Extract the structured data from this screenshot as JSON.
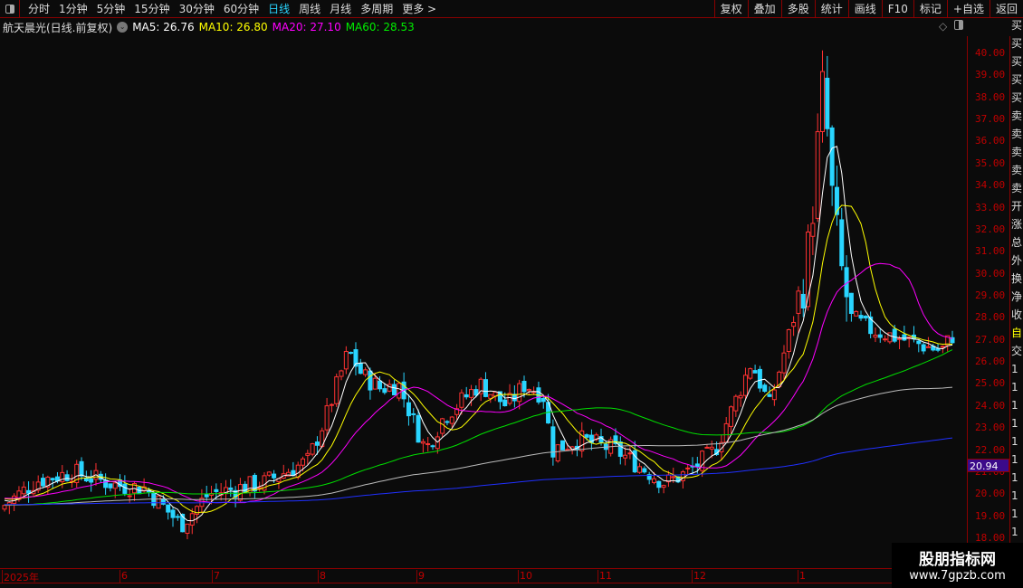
{
  "toolbar": {
    "periods": [
      "分时",
      "1分钟",
      "5分钟",
      "15分钟",
      "30分钟",
      "60分钟",
      "日线",
      "周线",
      "月线",
      "多周期",
      "更多 >"
    ],
    "active": "日线",
    "buttons": [
      "复权",
      "叠加",
      "多股",
      "统计",
      "画线",
      "F10",
      "标记",
      "+自选",
      "返回"
    ]
  },
  "info": {
    "title": "航天晨光(日线.前复权)",
    "ma5": "MA5: 26.76",
    "ma10": "MA10: 26.80",
    "ma20": "MA20: 27.10",
    "ma60": "MA60: 28.53"
  },
  "colors": {
    "up": "#ff3232",
    "down": "#29d5ff",
    "ma5": "#ffffff",
    "ma10": "#ffff00",
    "ma20": "#ff00ff",
    "ma60": "#00e000",
    "ma120": "#bbbbbb",
    "ma250": "#2030ff"
  },
  "yaxis": {
    "ticks": [
      "40.00",
      "39.00",
      "38.00",
      "37.00",
      "36.00",
      "35.00",
      "34.00",
      "33.00",
      "32.00",
      "31.00",
      "30.00",
      "29.00",
      "28.00",
      "27.00",
      "26.00",
      "25.00",
      "24.00",
      "23.00",
      "22.00",
      "21.00",
      "20.00",
      "19.00",
      "18.00"
    ],
    "min": 18,
    "max": 40
  },
  "price_tag": "20.94",
  "xaxis": {
    "labels": [
      "2025年",
      "6",
      "7",
      "8",
      "9",
      "10",
      "11",
      "12",
      "1"
    ]
  },
  "side_chars": [
    "买",
    "买",
    "买",
    "买",
    "买",
    "卖",
    "卖",
    "卖",
    "卖",
    "卖",
    "开",
    "涨",
    "总",
    "外",
    "换",
    "净",
    "收",
    "自",
    "交",
    "1",
    "1",
    "1",
    "1",
    "1",
    "1",
    "1",
    "1",
    "1",
    "1",
    "1"
  ],
  "watermark": {
    "line1": "股朋指标网",
    "line2": "www.7gpzb.com"
  },
  "chart_data": {
    "type": "candlestick",
    "anchors_price": [
      19.5,
      20.6,
      21,
      20.4,
      20.3,
      18.6,
      20,
      20.5,
      21.5,
      23.5,
      26.5,
      25.4,
      24.8,
      25,
      22,
      23.5,
      25,
      24,
      25,
      24.5,
      22,
      22.5,
      22,
      20.5,
      21,
      22,
      24,
      26,
      24,
      27,
      30,
      34,
      38.5,
      36,
      33,
      30,
      28,
      27.5,
      27,
      26.5,
      27.2
    ]
  }
}
